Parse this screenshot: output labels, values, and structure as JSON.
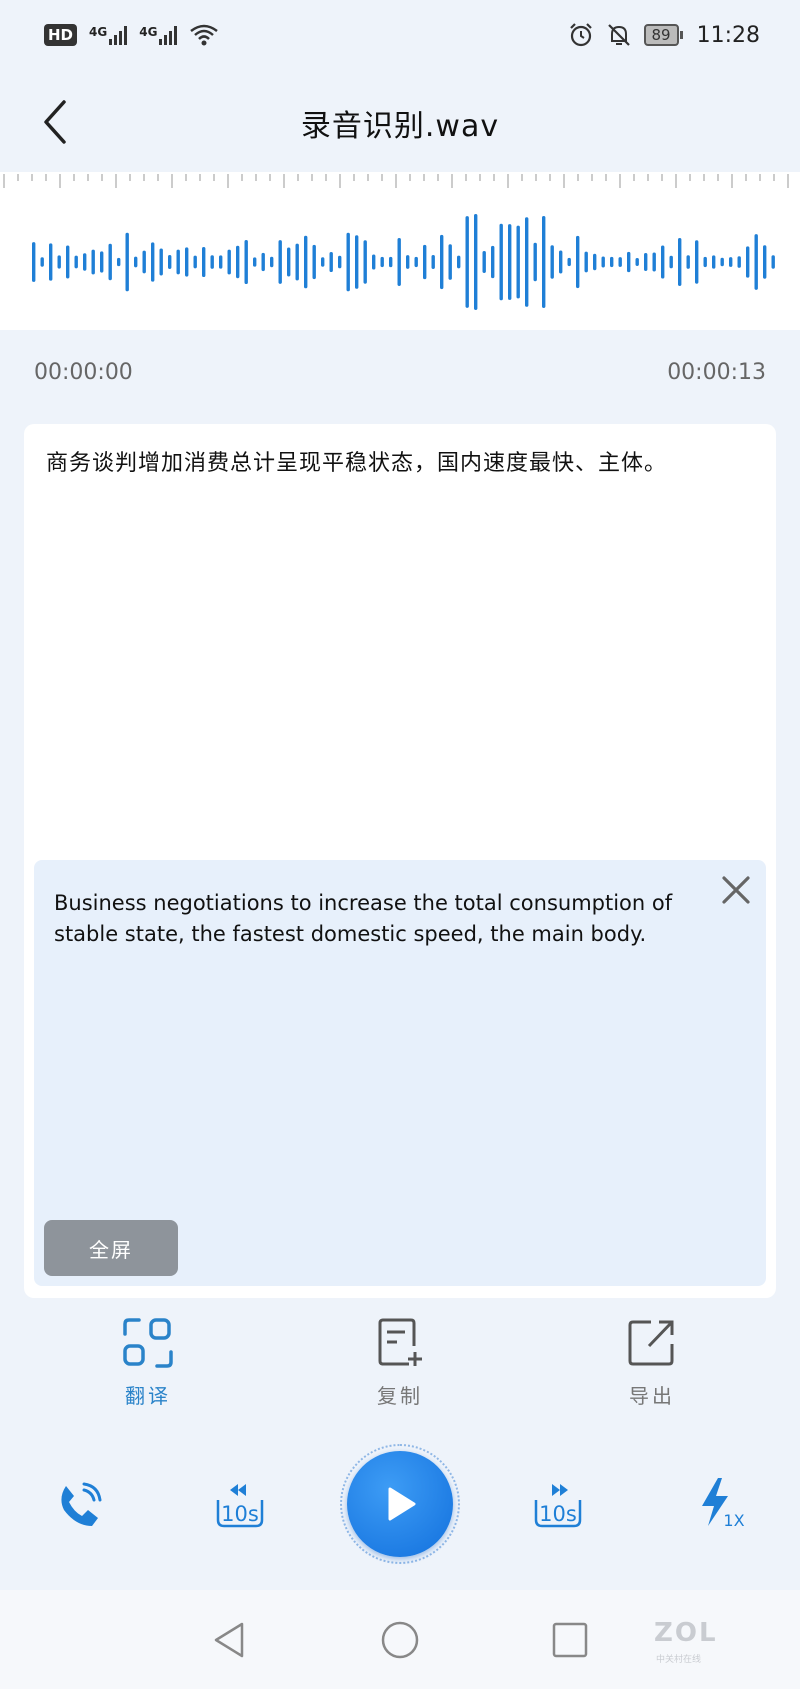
{
  "status_bar": {
    "hd": "HD",
    "net1": "4G",
    "net2": "4G",
    "battery": "89",
    "time": "11:28"
  },
  "header": {
    "title": "录音识别.wav"
  },
  "player_times": {
    "start": "00:00:00",
    "end": "00:00:13"
  },
  "transcript": {
    "text": "商务谈判增加消费总计呈现平稳状态，国内速度最快、主体。"
  },
  "translation": {
    "text": "Business negotiations to increase the total consumption of stable state, the fastest domestic speed, the main body.",
    "fullscreen_label": "全屏"
  },
  "actions": [
    {
      "label": "翻译",
      "icon": "translate-icon",
      "active": true
    },
    {
      "label": "复制",
      "icon": "copy-icon",
      "active": false
    },
    {
      "label": "导出",
      "icon": "export-icon",
      "active": false
    }
  ],
  "player": {
    "rewind_label": "10s",
    "forward_label": "10s",
    "speed_label": "1X"
  },
  "watermark": {
    "logo": "ZOL",
    "sub": "中关村在线"
  },
  "colors": {
    "accent": "#2a83c9",
    "wave": "#1f7fd6",
    "play": "#1676e0"
  }
}
